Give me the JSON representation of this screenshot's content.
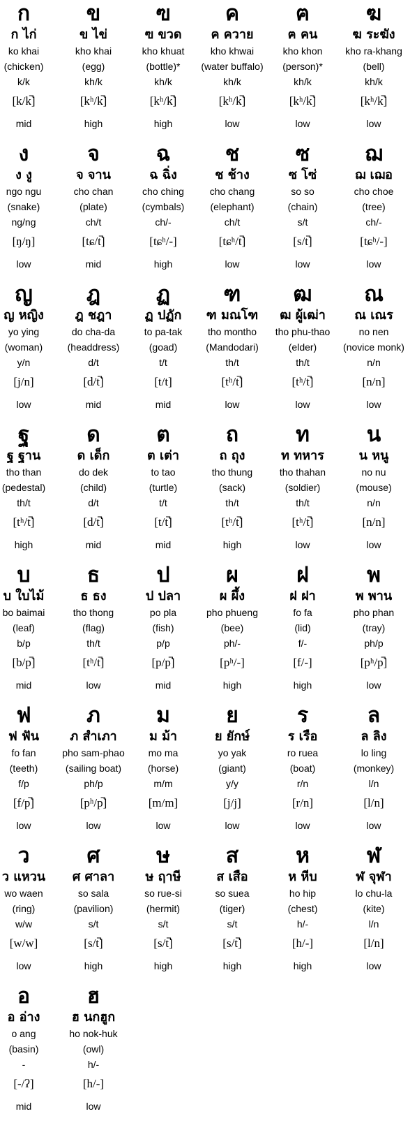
{
  "rows": [
    [
      {
        "letter": "ก",
        "word": "ก ไก่",
        "roman": "ko khai",
        "meaning": "(chicken)",
        "trans": "k/k",
        "ipa": "[k/k̚]",
        "tone": "mid"
      },
      {
        "letter": "ข",
        "word": "ข ไข่",
        "roman": "kho khai",
        "meaning": "(egg)",
        "trans": "kh/k",
        "ipa": "[kʰ/k̚]",
        "tone": "high"
      },
      {
        "letter": "ฃ",
        "word": "ฃ ขวด",
        "roman": "kho khuat",
        "meaning": "(bottle)*",
        "trans": "kh/k",
        "ipa": "[kʰ/k̚]",
        "tone": "high"
      },
      {
        "letter": "ค",
        "word": "ค ควาย",
        "roman": "kho khwai",
        "meaning": "(water buffalo)",
        "trans": "kh/k",
        "ipa": "[kʰ/k̚]",
        "tone": "low"
      },
      {
        "letter": "ฅ",
        "word": "ฅ คน",
        "roman": "kho khon",
        "meaning": "(person)*",
        "trans": "kh/k",
        "ipa": "[kʰ/k̚]",
        "tone": "low"
      },
      {
        "letter": "ฆ",
        "word": "ฆ ระฆัง",
        "roman": "kho ra-khang",
        "meaning": "(bell)",
        "trans": "kh/k",
        "ipa": "[kʰ/k̚]",
        "tone": "low"
      }
    ],
    [
      {
        "letter": "ง",
        "word": "ง งู",
        "roman": "ngo ngu",
        "meaning": "(snake)",
        "trans": "ng/ng",
        "ipa": "[ŋ/ŋ]",
        "tone": "low"
      },
      {
        "letter": "จ",
        "word": "จ จาน",
        "roman": "cho chan",
        "meaning": "(plate)",
        "trans": "ch/t",
        "ipa": "[tɕ/t̚]",
        "tone": "mid"
      },
      {
        "letter": "ฉ",
        "word": "ฉ ฉิ่ง",
        "roman": "cho ching",
        "meaning": "(cymbals)",
        "trans": "ch/-",
        "ipa": "[tɕʰ/-]",
        "tone": "high"
      },
      {
        "letter": "ช",
        "word": "ช ช้าง",
        "roman": "cho chang",
        "meaning": "(elephant)",
        "trans": "ch/t",
        "ipa": "[tɕʰ/t̚]",
        "tone": "low"
      },
      {
        "letter": "ซ",
        "word": "ซ โซ่",
        "roman": "so so",
        "meaning": "(chain)",
        "trans": "s/t",
        "ipa": "[s/t̚]",
        "tone": "low"
      },
      {
        "letter": "ฌ",
        "word": "ฌ เฌอ",
        "roman": "cho choe",
        "meaning": "(tree)",
        "trans": "ch/-",
        "ipa": "[tɕʰ/-]",
        "tone": "low"
      }
    ],
    [
      {
        "letter": "ญ",
        "word": "ญ หญิง",
        "roman": "yo ying",
        "meaning": "(woman)",
        "trans": "y/n",
        "ipa": "[j/n]",
        "tone": "low"
      },
      {
        "letter": "ฎ",
        "word": "ฎ ชฎา",
        "roman": "do cha-da",
        "meaning": "(headdress)",
        "trans": "d/t",
        "ipa": "[d/t̚]",
        "tone": "mid"
      },
      {
        "letter": "ฏ",
        "word": "ฏ ปฏัก",
        "roman": "to pa-tak",
        "meaning": "(goad)",
        "trans": "t/t",
        "ipa": "[t/t]",
        "tone": "mid"
      },
      {
        "letter": "ฑ",
        "word": "ฑ มณโฑ",
        "roman": "tho montho",
        "meaning": "(Mandodari)",
        "trans": "th/t",
        "ipa": "[tʰ/t̚]",
        "tone": "low"
      },
      {
        "letter": "ฒ",
        "word": "ฒ ผู้เฒ่า",
        "roman": "tho phu-thao",
        "meaning": "(elder)",
        "trans": "th/t",
        "ipa": "[tʰ/t̚]",
        "tone": "low"
      },
      {
        "letter": "ณ",
        "word": "ณ เณร",
        "roman": "no nen",
        "meaning": "(novice monk)",
        "trans": "n/n",
        "ipa": "[n/n]",
        "tone": "low"
      }
    ],
    [
      {
        "letter": "ฐ",
        "word": "ฐ ฐาน",
        "roman": "tho than",
        "meaning": "(pedestal)",
        "trans": "th/t",
        "ipa": "[tʰ/t̚]",
        "tone": "high"
      },
      {
        "letter": "ด",
        "word": "ด เด็ก",
        "roman": "do dek",
        "meaning": "(child)",
        "trans": "d/t",
        "ipa": "[d/t̚]",
        "tone": "mid"
      },
      {
        "letter": "ต",
        "word": "ต เต่า",
        "roman": "to tao",
        "meaning": "(turtle)",
        "trans": "t/t",
        "ipa": "[t/t̚]",
        "tone": "mid"
      },
      {
        "letter": "ถ",
        "word": "ถ ถุง",
        "roman": "tho thung",
        "meaning": "(sack)",
        "trans": "th/t",
        "ipa": "[tʰ/t̚]",
        "tone": "high"
      },
      {
        "letter": "ท",
        "word": "ท ทหาร",
        "roman": "tho thahan",
        "meaning": "(soldier)",
        "trans": "th/t",
        "ipa": "[tʰ/t̚]",
        "tone": "low"
      },
      {
        "letter": "น",
        "word": "น หนู",
        "roman": "no nu",
        "meaning": "(mouse)",
        "trans": "n/n",
        "ipa": "[n/n]",
        "tone": "low"
      }
    ],
    [
      {
        "letter": "บ",
        "word": "บ ใบไม้",
        "roman": "bo baimai",
        "meaning": "(leaf)",
        "trans": "b/p",
        "ipa": "[b/p̚]",
        "tone": "mid"
      },
      {
        "letter": "ธ",
        "word": "ธ ธง",
        "roman": "tho thong",
        "meaning": "(flag)",
        "trans": "th/t",
        "ipa": "[tʰ/t̚]",
        "tone": "low"
      },
      {
        "letter": "ป",
        "word": "ป ปลา",
        "roman": "po pla",
        "meaning": "(fish)",
        "trans": "p/p",
        "ipa": "[p/p̚]",
        "tone": "mid"
      },
      {
        "letter": "ผ",
        "word": "ผ ผึ้ง",
        "roman": "pho phueng",
        "meaning": "(bee)",
        "trans": "ph/-",
        "ipa": "[pʰ/-]",
        "tone": "high"
      },
      {
        "letter": "ฝ",
        "word": "ฝ ฝา",
        "roman": "fo fa",
        "meaning": "(lid)",
        "trans": "f/-",
        "ipa": "[f/-]",
        "tone": "high"
      },
      {
        "letter": "พ",
        "word": "พ พาน",
        "roman": "pho phan",
        "meaning": "(tray)",
        "trans": "ph/p",
        "ipa": "[pʰ/p̚]",
        "tone": "low"
      }
    ],
    [
      {
        "letter": "ฟ",
        "word": "ฟ ฟัน",
        "roman": "fo fan",
        "meaning": "(teeth)",
        "trans": "f/p",
        "ipa": "[f/p̚]",
        "tone": "low"
      },
      {
        "letter": "ภ",
        "word": "ภ สำเภา",
        "roman": "pho sam-phao",
        "meaning": "(sailing boat)",
        "trans": "ph/p",
        "ipa": "[pʰ/p̚]",
        "tone": "low"
      },
      {
        "letter": "ม",
        "word": "ม ม้า",
        "roman": "mo ma",
        "meaning": "(horse)",
        "trans": "m/m",
        "ipa": "[m/m]",
        "tone": "low"
      },
      {
        "letter": "ย",
        "word": "ย ยักษ์",
        "roman": "yo yak",
        "meaning": "(giant)",
        "trans": "y/y",
        "ipa": "[j/j]",
        "tone": "low"
      },
      {
        "letter": "ร",
        "word": "ร เรือ",
        "roman": "ro ruea",
        "meaning": "(boat)",
        "trans": "r/n",
        "ipa": "[r/n]",
        "tone": "low"
      },
      {
        "letter": "ล",
        "word": "ล ลิง",
        "roman": "lo ling",
        "meaning": "(monkey)",
        "trans": "l/n",
        "ipa": "[l/n]",
        "tone": "low"
      }
    ],
    [
      {
        "letter": "ว",
        "word": "ว แหวน",
        "roman": "wo waen",
        "meaning": "(ring)",
        "trans": "w/w",
        "ipa": "[w/w]",
        "tone": "low"
      },
      {
        "letter": "ศ",
        "word": "ศ ศาลา",
        "roman": "so sala",
        "meaning": "(pavilion)",
        "trans": "s/t",
        "ipa": "[s/t̚]",
        "tone": "high"
      },
      {
        "letter": "ษ",
        "word": "ษ ฤาษี",
        "roman": "so rue-si",
        "meaning": "(hermit)",
        "trans": "s/t",
        "ipa": "[s/t̚]",
        "tone": "high"
      },
      {
        "letter": "ส",
        "word": "ส เสือ",
        "roman": "so suea",
        "meaning": "(tiger)",
        "trans": "s/t",
        "ipa": "[s/t̚]",
        "tone": "high"
      },
      {
        "letter": "ห",
        "word": "ห หีบ",
        "roman": "ho hip",
        "meaning": "(chest)",
        "trans": "h/-",
        "ipa": "[h/-]",
        "tone": "high"
      },
      {
        "letter": "ฬ",
        "word": "ฬ จุฬา",
        "roman": "lo chu-la",
        "meaning": "(kite)",
        "trans": "l/n",
        "ipa": "[l/n]",
        "tone": "low"
      }
    ],
    [
      {
        "letter": "อ",
        "word": "อ อ่าง",
        "roman": "o ang",
        "meaning": "(basin)",
        "trans": "-",
        "ipa": "[-/ʔ]",
        "tone": "mid"
      },
      {
        "letter": "ฮ",
        "word": "ฮ นกฮูก",
        "roman": "ho nok-huk",
        "meaning": "(owl)",
        "trans": "h/-",
        "ipa": "[h/-]",
        "tone": "low"
      }
    ]
  ]
}
